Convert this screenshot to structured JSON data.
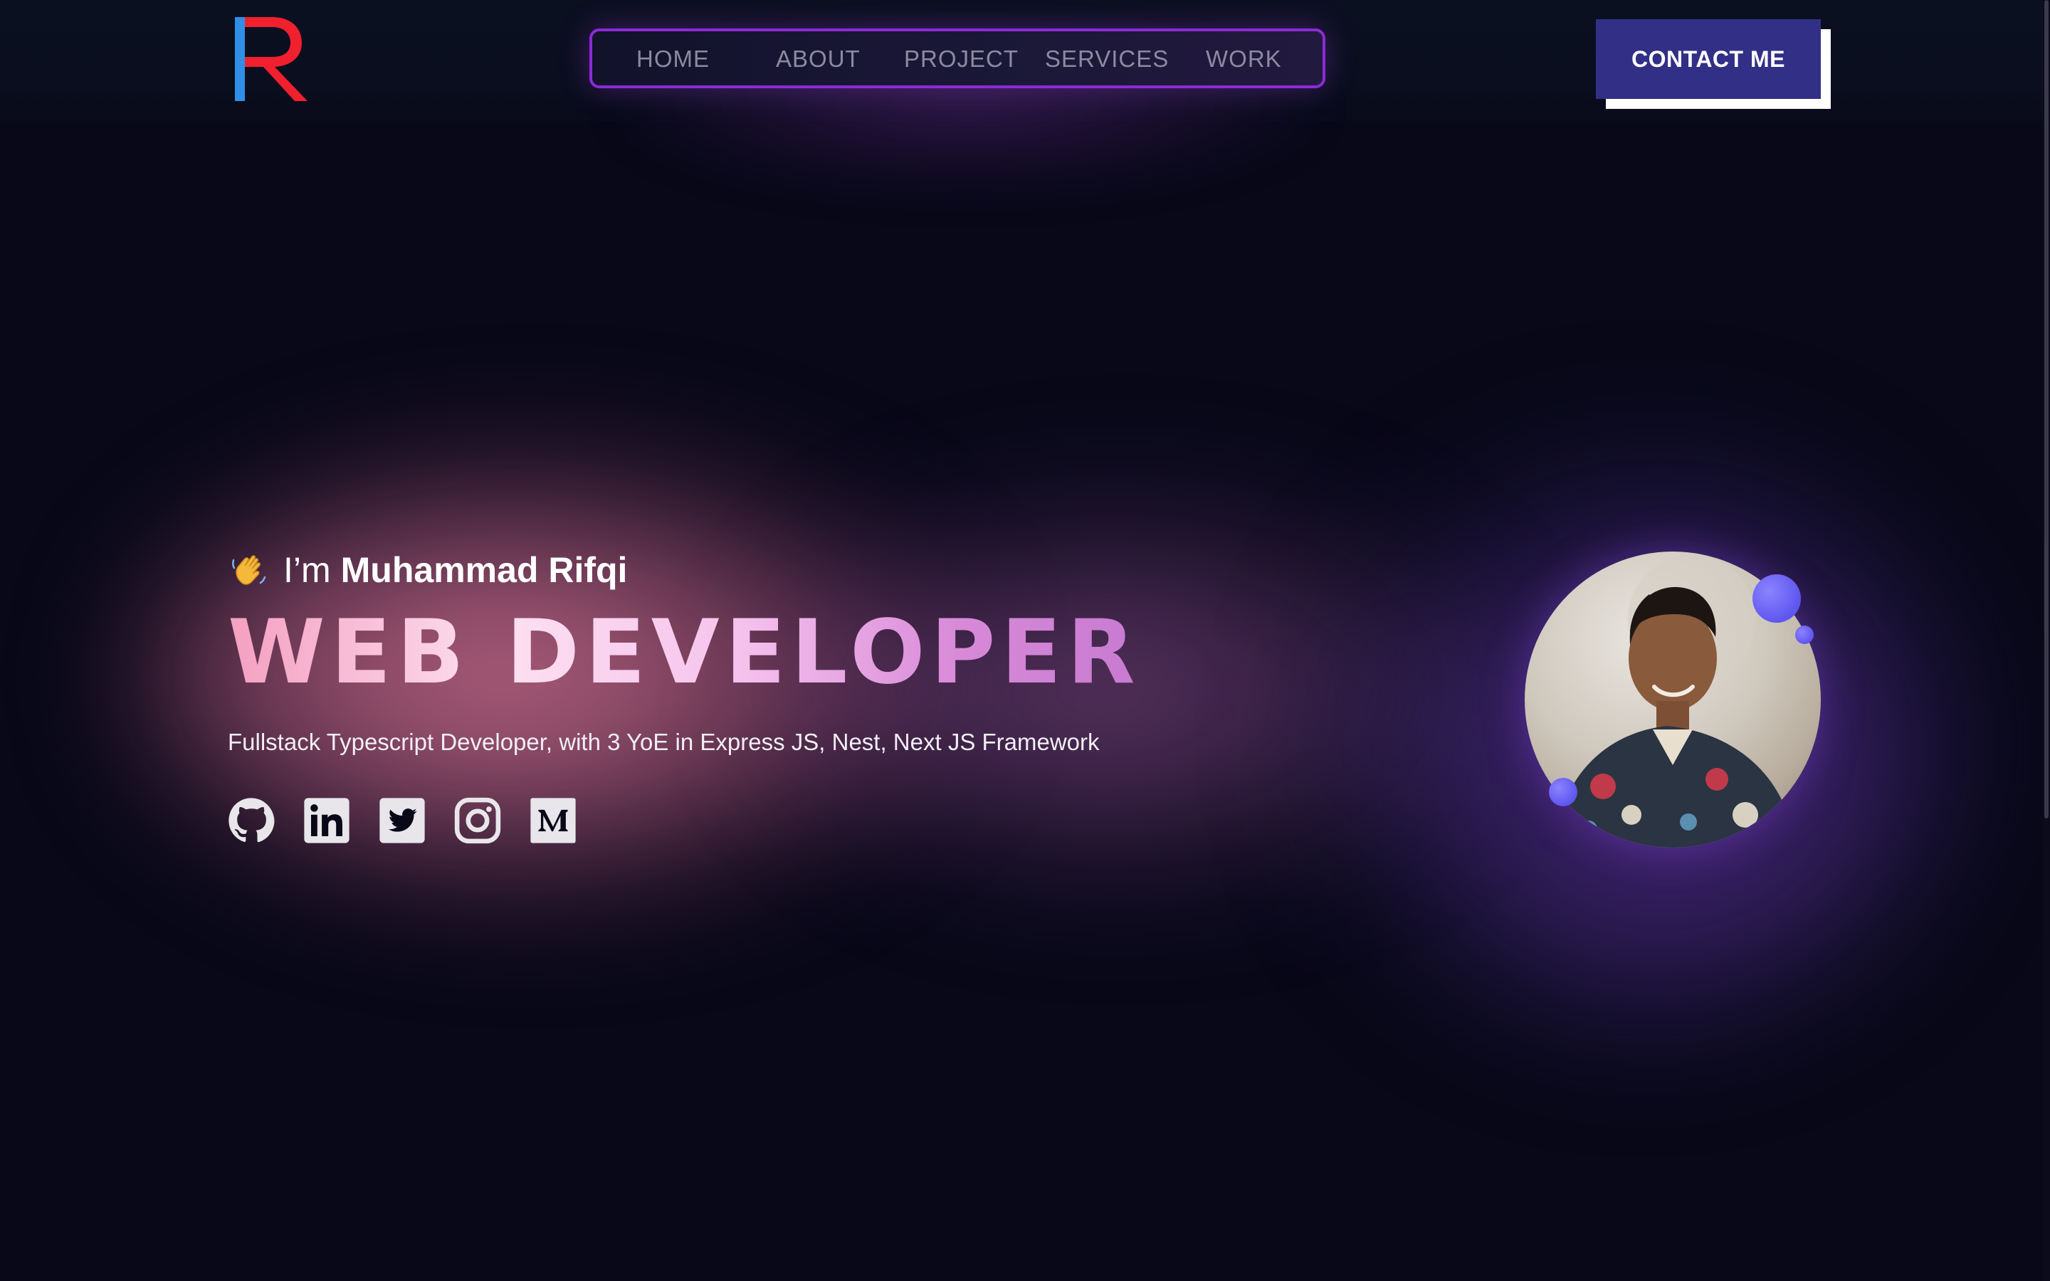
{
  "header": {
    "logo_letter": "R",
    "nav": [
      {
        "label": "HOME"
      },
      {
        "label": "ABOUT"
      },
      {
        "label": "PROJECT"
      },
      {
        "label": "SERVICES"
      },
      {
        "label": "WORK"
      }
    ],
    "contact_label": "CONTACT ME"
  },
  "hero": {
    "greeting_prefix": "I’m",
    "name": "Muhammad Rifqi",
    "headline": "WEB DEVELOPER",
    "subtitle": "Fullstack Typescript Developer, with 3 YoE in Express JS, Nest, Next JS Framework",
    "socials": [
      {
        "icon": "github-icon"
      },
      {
        "icon": "linkedin-icon"
      },
      {
        "icon": "twitter-icon"
      },
      {
        "icon": "instagram-icon"
      },
      {
        "icon": "medium-icon"
      }
    ]
  },
  "colors": {
    "background": "#080818",
    "nav_border": "#8b2bd6",
    "contact_button": "#322f86",
    "logo_blue": "#2f8fe6",
    "logo_red": "#f0202e",
    "bubble": "#6b63f5"
  }
}
